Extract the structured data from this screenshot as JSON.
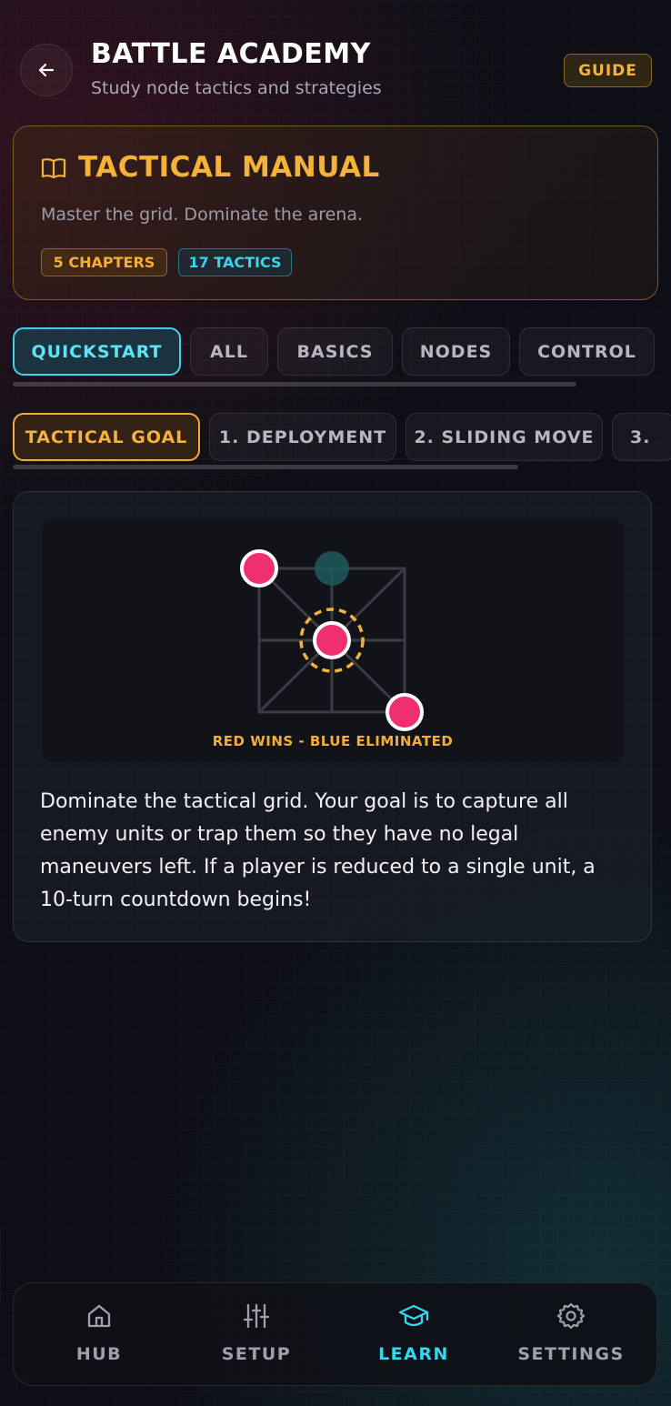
{
  "header": {
    "title": "BATTLE ACADEMY",
    "subtitle": "Study node tactics and strategies",
    "back_icon": "arrow-left-icon",
    "guide_label": "GUIDE"
  },
  "manual": {
    "icon": "book-open-icon",
    "title": "TACTICAL MANUAL",
    "tagline": "Master the grid. Dominate the arena.",
    "chapters_badge": "5 CHAPTERS",
    "tactics_badge": "17 TACTICS"
  },
  "category_tabs": [
    {
      "label": "QUICKSTART",
      "active": true
    },
    {
      "label": "ALL",
      "active": false
    },
    {
      "label": "BASICS",
      "active": false
    },
    {
      "label": "NODES",
      "active": false
    },
    {
      "label": "CONTROL",
      "active": false
    }
  ],
  "lesson_tabs": [
    {
      "label": "TACTICAL GOAL",
      "active": true
    },
    {
      "label": "1. DEPLOYMENT",
      "active": false
    },
    {
      "label": "2. SLIDING MOVE",
      "active": false
    },
    {
      "label": "3.",
      "active": false
    }
  ],
  "lesson": {
    "result_caption": "RED WINS - BLUE ELIMINATED",
    "description": "Dominate the tactical grid. Your goal is to capture all enemy units or trap them so they have no legal maneuvers left. If a player is reduced to a single unit, a 10-turn countdown begins!"
  },
  "colors": {
    "accent_gold": "#f5b23a",
    "accent_cyan": "#35d6ee",
    "red_unit": "#f0306e",
    "blue_ghost": "#1f5a5c"
  },
  "bottom_nav": [
    {
      "label": "HUB",
      "icon": "home-icon",
      "active": false
    },
    {
      "label": "SETUP",
      "icon": "sliders-icon",
      "active": false
    },
    {
      "label": "LEARN",
      "icon": "graduation-cap-icon",
      "active": true
    },
    {
      "label": "SETTINGS",
      "icon": "gear-icon",
      "active": false
    }
  ]
}
